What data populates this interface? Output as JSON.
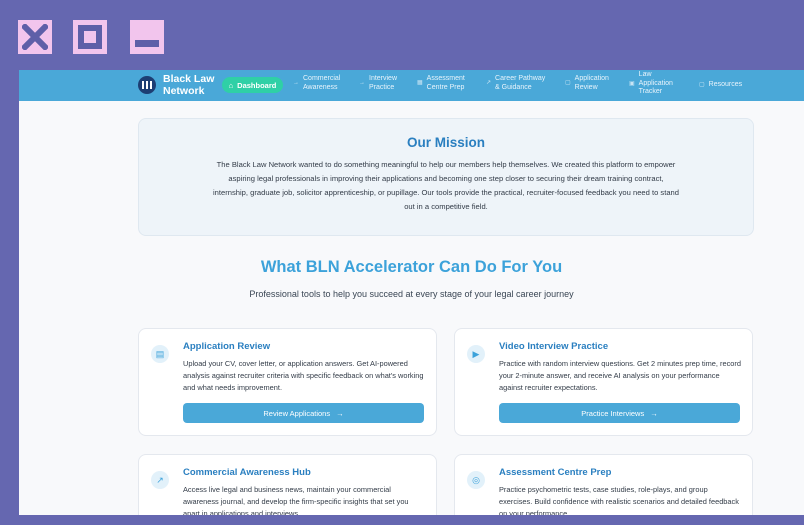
{
  "window_controls": {
    "close": "close-icon",
    "maximize": "maximize-icon",
    "minimize": "minimize-icon",
    "color": "#f2c5ed"
  },
  "nav": {
    "brand": "Black Law Network",
    "dashboard": "Dashboard",
    "items": [
      {
        "label": "Commercial\nAwareness",
        "icon": "→"
      },
      {
        "label": "Interview\nPractice",
        "icon": "→"
      },
      {
        "label": "Assessment\nCentre Prep",
        "icon": "▦"
      },
      {
        "label": "Career Pathway\n& Guidance",
        "icon": "↗"
      },
      {
        "label": "Application\nReview",
        "icon": "▢"
      },
      {
        "label": "Law\nApplication\nTracker",
        "icon": "▣"
      },
      {
        "label": "Resources",
        "icon": "▢"
      }
    ],
    "colors": {
      "bar": "#4aa8d8",
      "active": "#2fd0a6",
      "logo": "#1d3e73"
    }
  },
  "mission": {
    "title": "Our Mission",
    "body": "The Black Law Network wanted to do something meaningful to help our members help themselves. We created this platform to empower aspiring legal professionals in improving their applications and becoming one step closer to securing their dream training contract, internship, graduate job, solicitor apprenticeship, or pupillage. Our tools provide the practical, recruiter-focused feedback you need to stand out in a competitive field."
  },
  "section": {
    "title": "What BLN Accelerator Can Do For You",
    "subtitle": "Professional tools to help you succeed at every stage of your legal career journey"
  },
  "cards": [
    {
      "title": "Application Review",
      "icon": "document-icon",
      "glyph": "▤",
      "body": "Upload your CV, cover letter, or application answers. Get AI-powered analysis against recruiter criteria with specific feedback on what's working and what needs improvement.",
      "button": "Review Applications"
    },
    {
      "title": "Video Interview Practice",
      "icon": "video-icon",
      "glyph": "▶",
      "body": "Practice with random interview questions. Get 2 minutes prep time, record your 2-minute answer, and receive AI analysis on your performance against recruiter expectations.",
      "button": "Practice Interviews"
    },
    {
      "title": "Commercial Awareness Hub",
      "icon": "trend-icon",
      "glyph": "↗",
      "body": "Access live legal and business news, maintain your commercial awareness journal, and develop the firm-specific insights that set you apart in applications and interviews."
    },
    {
      "title": "Assessment Centre Prep",
      "icon": "target-icon",
      "glyph": "◎",
      "body": "Practice psychometric tests, case studies, role-plays, and group exercises. Build confidence with realistic scenarios and detailed feedback on your performance."
    }
  ]
}
